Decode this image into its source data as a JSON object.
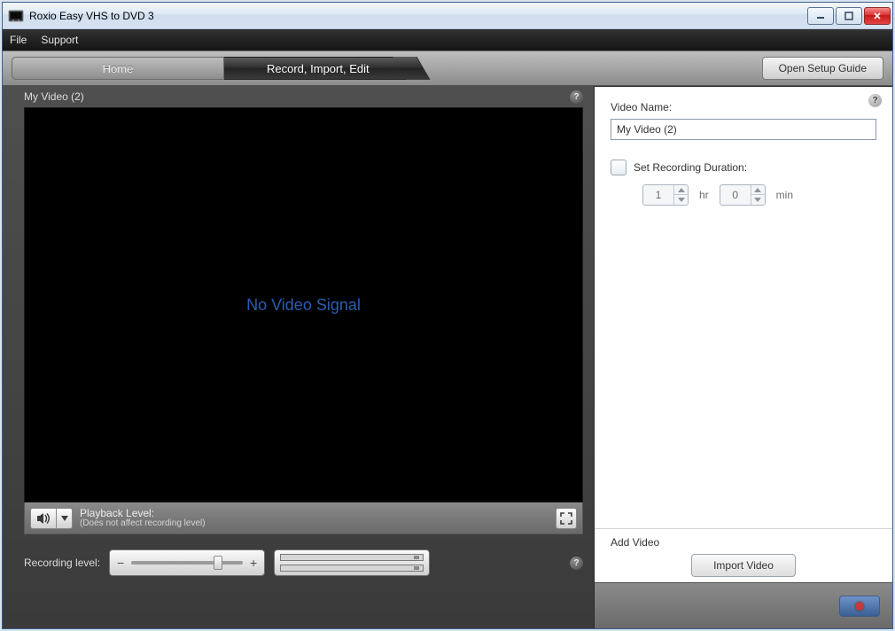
{
  "window": {
    "title": "Roxio Easy VHS to DVD 3"
  },
  "menu": {
    "file": "File",
    "support": "Support"
  },
  "tabs": {
    "home": "Home",
    "record": "Record, Import, Edit"
  },
  "setup_guide_label": "Open Setup Guide",
  "video": {
    "title": "My Video (2)",
    "signal_text": "No Video Signal",
    "playback_label": "Playback Level:",
    "playback_note": "(Does not affect recording level)"
  },
  "recording": {
    "label": "Recording level:"
  },
  "right": {
    "video_name_label": "Video Name:",
    "video_name_value": "My Video (2)",
    "set_duration_label": "Set Recording Duration:",
    "hours_value": "1",
    "hours_unit": "hr",
    "minutes_value": "0",
    "minutes_unit": "min",
    "add_video_label": "Add Video",
    "import_label": "Import Video"
  }
}
